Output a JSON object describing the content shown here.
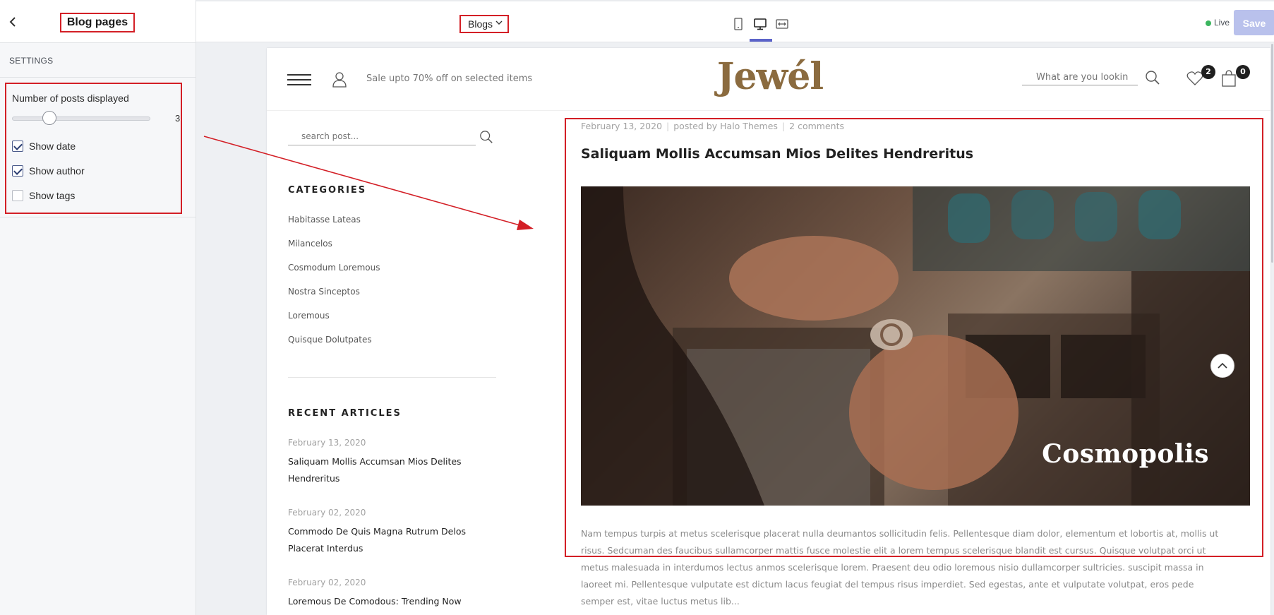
{
  "editor": {
    "panel_title": "Blog pages",
    "back_icon": "chevron-left-icon",
    "settings_heading": "SETTINGS",
    "posts_label": "Number of posts displayed",
    "posts_value": "3",
    "checkboxes": [
      {
        "label": "Show date",
        "checked": true
      },
      {
        "label": "Show author",
        "checked": true
      },
      {
        "label": "Show tags",
        "checked": false
      }
    ],
    "page_select": "Blogs",
    "live_label": "Live",
    "save_label": "Save",
    "active_device": "desktop",
    "colors": {
      "highlight_box": "#d31f26",
      "live": "#3bb55e",
      "save_disabled": "#b9c1ec",
      "device_active": "#5b63c9"
    }
  },
  "store": {
    "promo": "Sale upto 70% off on selected items",
    "logo": "Jewél",
    "search_placeholder": "What are you lookin",
    "wishlist_count": "2",
    "cart_count": "0",
    "logo_color": "#8b6b3f"
  },
  "sidebar": {
    "search_placeholder": "search post...",
    "categories_heading": "CATEGORIES",
    "categories": [
      "Habitasse Lateas",
      "Milancelos",
      "Cosmodum Loremous",
      "Nostra Sinceptos",
      "Loremous",
      "Quisque Dolutpates"
    ],
    "recent_heading": "RECENT ARTICLES",
    "recent": [
      {
        "date": "February 13, 2020",
        "title": "Saliquam Mollis Accumsan Mios Delites Hendreritus"
      },
      {
        "date": "February 02, 2020",
        "title": "Commodo De Quis Magna Rutrum Delos Placerat Interdus"
      },
      {
        "date": "February 02, 2020",
        "title": "Loremous De Comodous: Trending Now"
      }
    ]
  },
  "article": {
    "date": "February 13, 2020",
    "author": "posted by Halo Themes",
    "comments": "2 comments",
    "title": "Saliquam Mollis Accumsan Mios Delites Hendreritus",
    "image_caption": "Cosmopolis",
    "excerpt": "Nam tempus turpis at metus scelerisque placerat nulla deumantos sollicitudin felis. Pellentesque diam dolor, elementum et lobortis at, mollis ut risus. Sedcuman des faucibus sullamcorper mattis fusce molestie elit a lorem tempus scelerisque blandit est cursus. Quisque volutpat orci ut metus malesuada in interdumos lectus anmos scelerisque lorem. Praesent deu odio loremous nisio dullamcorper sultricies. suscipit massa in laoreet mi. Pellentesque vulputate est dictum lacus feugiat del tempus risus imperdiet. Sed egestas, ante et vulputate volutpat, eros pede semper est, vitae luctus metus lib..."
  }
}
